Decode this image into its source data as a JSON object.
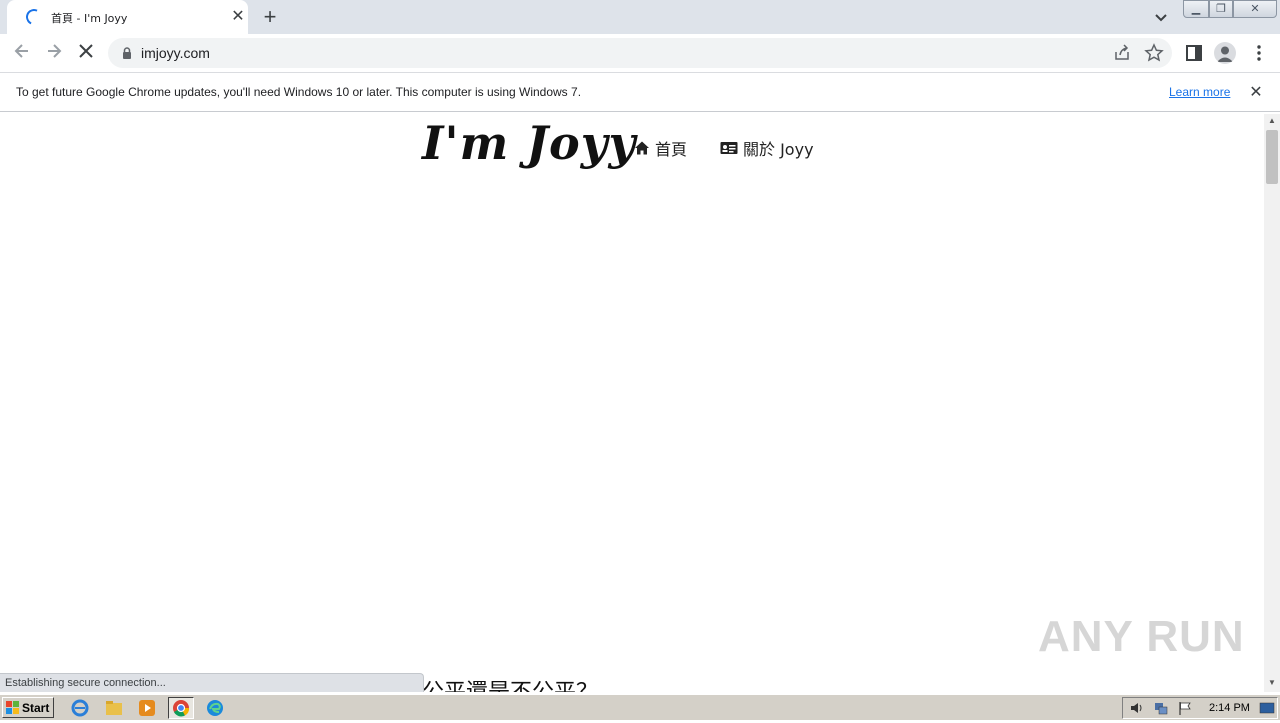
{
  "browser": {
    "tab": {
      "title": "首頁 - I'm Joyy",
      "close_glyph": "✕"
    },
    "new_tab_glyph": "+",
    "url": "imjoyy.com",
    "infobar": {
      "message": "To get future Google Chrome updates, you'll need Windows 10 or later. This computer is using Windows 7.",
      "link": "Learn more",
      "close_glyph": "✕"
    },
    "status": "Establishing secure connection..."
  },
  "page": {
    "logo": "I'm Joyy",
    "nav": [
      {
        "label": "首頁",
        "icon": "home-icon"
      },
      {
        "label": "關於 Joyy",
        "icon": "id-card-icon"
      }
    ],
    "article_title_partial": "公平還是不公平？"
  },
  "watermark": "ANY RUN",
  "taskbar": {
    "start_label": "Start",
    "clock": "2:14 PM"
  },
  "colors": {
    "accent": "#1a73e8",
    "tabstrip": "#dee3ea",
    "taskbar": "#d4d0c8"
  }
}
